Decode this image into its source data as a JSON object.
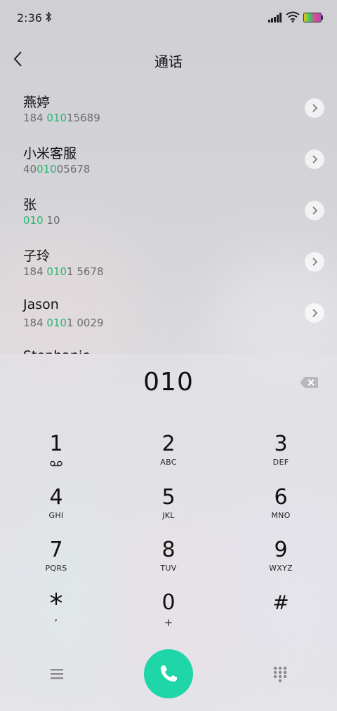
{
  "status_bar": {
    "time": "2:36"
  },
  "header": {
    "title": "通话"
  },
  "contacts": [
    {
      "name": "燕婷",
      "number_parts": [
        "184 ",
        "010",
        "15689"
      ]
    },
    {
      "name": "小米客服",
      "number_parts": [
        "40",
        "010",
        "05678"
      ]
    },
    {
      "name": "张",
      "number_parts": [
        "",
        "010",
        " 10"
      ]
    },
    {
      "name": "子玲",
      "number_parts": [
        "184 ",
        "010",
        "1 5678"
      ]
    },
    {
      "name": "Jason",
      "number_parts": [
        "184 ",
        "010",
        "1 0029"
      ]
    },
    {
      "name": "Stephanie",
      "number_parts": [
        "",
        "",
        ""
      ]
    }
  ],
  "dialer": {
    "input": "010",
    "keys": [
      {
        "digit": "1",
        "letters": ""
      },
      {
        "digit": "2",
        "letters": "ABC"
      },
      {
        "digit": "3",
        "letters": "DEF"
      },
      {
        "digit": "4",
        "letters": "GHI"
      },
      {
        "digit": "5",
        "letters": "JKL"
      },
      {
        "digit": "6",
        "letters": "MNO"
      },
      {
        "digit": "7",
        "letters": "PQRS"
      },
      {
        "digit": "8",
        "letters": "TUV"
      },
      {
        "digit": "9",
        "letters": "WXYZ"
      },
      {
        "digit": "*",
        "letters": ","
      },
      {
        "digit": "0",
        "letters": "+"
      },
      {
        "digit": "#",
        "letters": ""
      }
    ]
  },
  "colors": {
    "accent": "#1fd6a8",
    "match_highlight": "#2ab673"
  },
  "icons": [
    "bluetooth-icon",
    "signal-icon",
    "wifi-icon",
    "battery-icon",
    "back-icon",
    "chevron-right-icon",
    "backspace-icon",
    "voicemail-icon",
    "menu-icon",
    "phone-icon",
    "dialpad-icon"
  ]
}
